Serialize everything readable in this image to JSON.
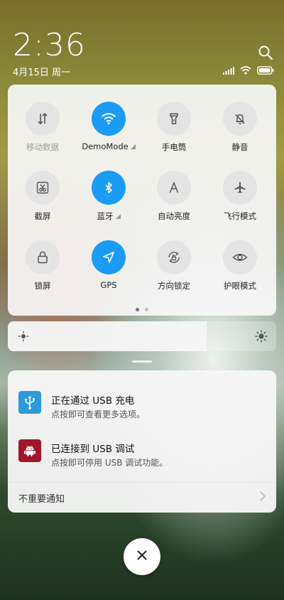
{
  "status": {
    "time": "2:36",
    "date": "4月15日 周一",
    "icons": [
      "signal-icon",
      "wifi-icon",
      "battery-icon"
    ]
  },
  "quick_settings": {
    "tiles": [
      {
        "name": "mobile-data",
        "label": "移动数据",
        "icon": "mobile-data-icon",
        "active": false,
        "disabled": true
      },
      {
        "name": "wifi",
        "label": "DemoMode",
        "icon": "wifi-icon",
        "active": true,
        "has_more": true
      },
      {
        "name": "flashlight",
        "label": "手电筒",
        "icon": "flashlight-icon",
        "active": false
      },
      {
        "name": "mute",
        "label": "静音",
        "icon": "bell-off-icon",
        "active": false
      },
      {
        "name": "screenshot",
        "label": "截屏",
        "icon": "scissors-icon",
        "active": false
      },
      {
        "name": "bluetooth",
        "label": "蓝牙",
        "icon": "bluetooth-icon",
        "active": true,
        "has_more": true
      },
      {
        "name": "auto-brightness",
        "label": "自动亮度",
        "icon": "letter-a-icon",
        "active": false
      },
      {
        "name": "airplane-mode",
        "label": "飞行模式",
        "icon": "airplane-icon",
        "active": false
      },
      {
        "name": "lock-screen",
        "label": "锁屏",
        "icon": "lock-icon",
        "active": false
      },
      {
        "name": "gps",
        "label": "GPS",
        "icon": "navigation-icon",
        "active": true
      },
      {
        "name": "rotation-lock",
        "label": "方向锁定",
        "icon": "rotation-lock-icon",
        "active": false
      },
      {
        "name": "eye-protection",
        "label": "护眼模式",
        "icon": "eye-icon",
        "active": false
      }
    ],
    "pages": 2,
    "current_page": 1
  },
  "brightness": {
    "level_fraction": 0.74
  },
  "notifications": {
    "items": [
      {
        "title": "正在通过 USB 充电",
        "body": "点按即可查看更多选项。",
        "icon": "usb-icon",
        "icon_color": "#2f9ad8"
      },
      {
        "title": "已连接到 USB 调试",
        "body": "点按即可停用 USB 调试功能。",
        "icon": "android-icon",
        "icon_color": "#a0162b"
      }
    ],
    "footer": "不重要通知"
  },
  "colors": {
    "accent": "#1a9cf5"
  }
}
